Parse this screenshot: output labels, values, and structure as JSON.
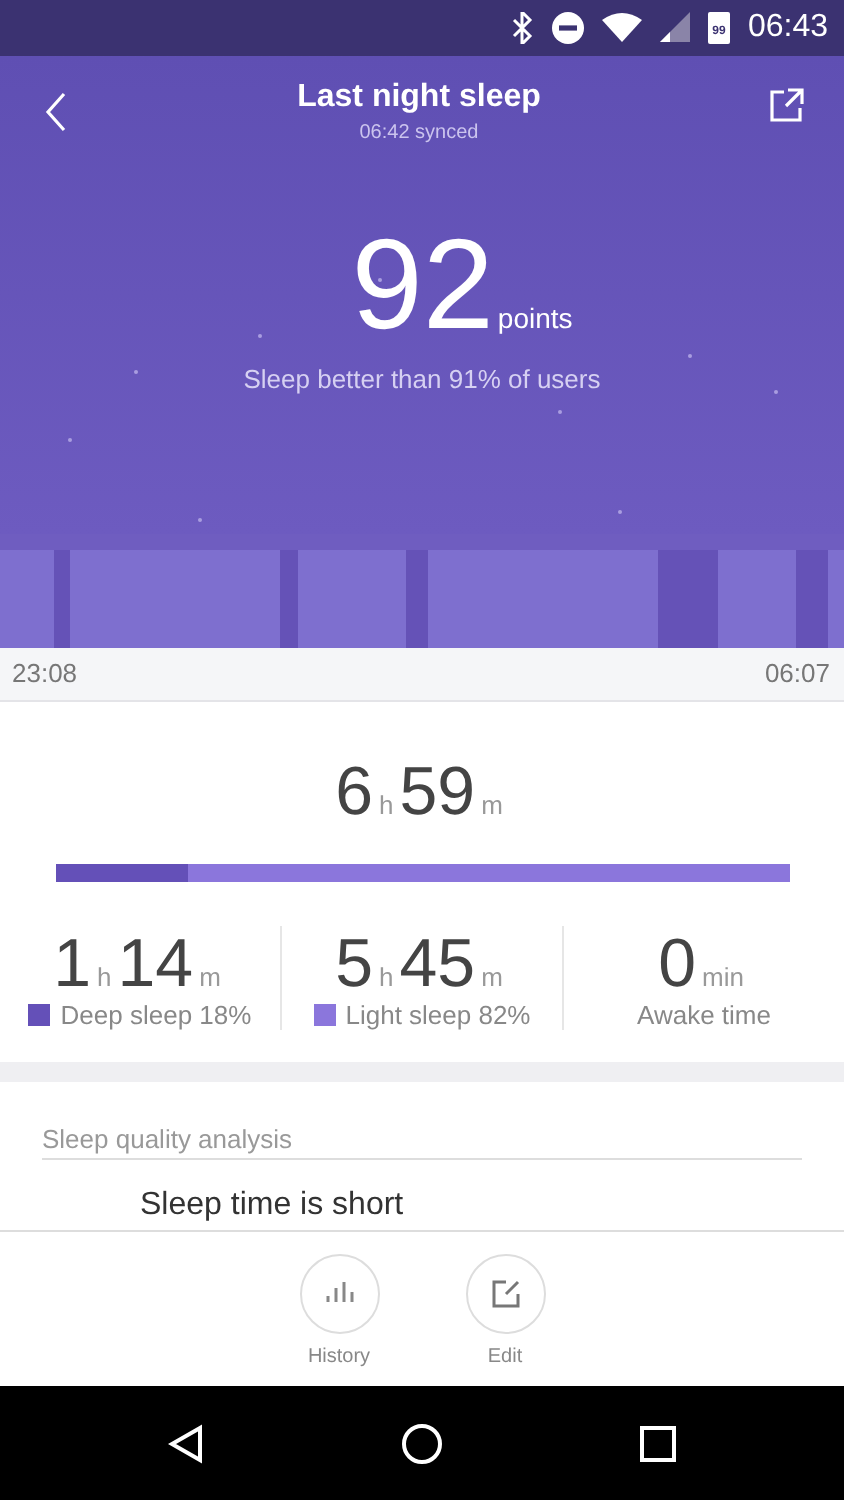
{
  "status_bar": {
    "time": "06:43",
    "battery": "99"
  },
  "header": {
    "title": "Last night sleep",
    "subtitle": "06:42 synced",
    "score": "92",
    "score_unit": "points",
    "comparison": "Sleep better than 91% of users"
  },
  "timeline": {
    "start": "23:08",
    "end": "06:07"
  },
  "total": {
    "hours": "6",
    "hours_unit": "h",
    "minutes": "59",
    "minutes_unit": "m",
    "level": 0.18
  },
  "stats": [
    {
      "kind": "duration",
      "hours": "1",
      "hours_unit": "h",
      "minutes": "14",
      "minutes_unit": "m",
      "label": "Deep sleep 18%",
      "color": "#6450b8"
    },
    {
      "kind": "duration",
      "hours": "5",
      "hours_unit": "h",
      "minutes": "45",
      "minutes_unit": "m",
      "label": "Light sleep 82%",
      "color": "#8b76dc"
    },
    {
      "kind": "minutes",
      "minutes": "0",
      "minutes_unit": "min",
      "label": "Awake time"
    }
  ],
  "analysis": {
    "heading": "Sleep quality analysis",
    "result": "Sleep time is short"
  },
  "actions": [
    {
      "kind": "history",
      "label": "History"
    },
    {
      "kind": "edit",
      "label": "Edit"
    }
  ]
}
